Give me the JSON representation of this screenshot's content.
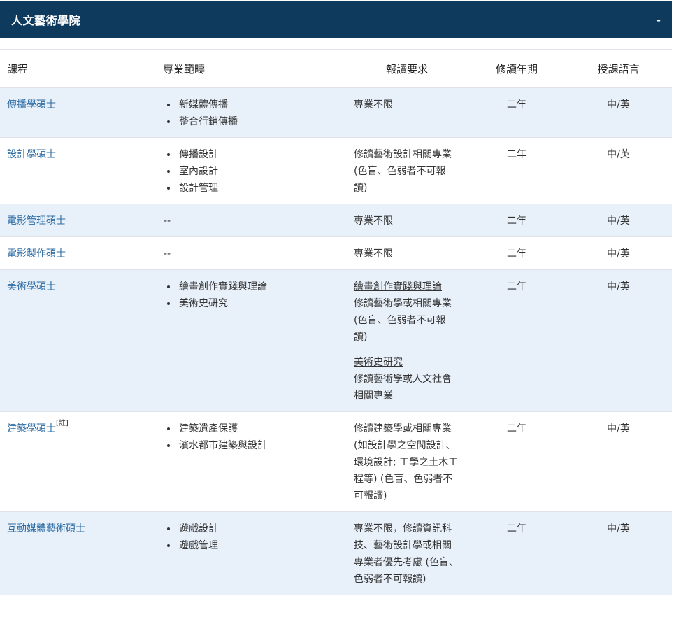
{
  "panel": {
    "title": "人文藝術學院",
    "toggle": "-"
  },
  "headers": {
    "course": "課程",
    "range": "專業範疇",
    "req": "報讀要求",
    "years": "修讀年期",
    "lang": "授課語言"
  },
  "rows": [
    {
      "course": "傳播學碩士",
      "note": "",
      "range": [
        "新媒體傳播",
        "整合行銷傳播"
      ],
      "req": [
        {
          "sub": "",
          "text": "專業不限"
        }
      ],
      "years": "二年",
      "lang": "中/英"
    },
    {
      "course": "設計學碩士",
      "note": "",
      "range": [
        "傳播設計",
        "室內設計",
        "設計管理"
      ],
      "req": [
        {
          "sub": "",
          "text": "修讀藝術設計相關專業(色盲、色弱者不可報讀)"
        }
      ],
      "years": "二年",
      "lang": "中/英"
    },
    {
      "course": "電影管理碩士",
      "note": "",
      "range_text": "--",
      "req": [
        {
          "sub": "",
          "text": "專業不限"
        }
      ],
      "years": "二年",
      "lang": "中/英"
    },
    {
      "course": "電影製作碩士",
      "note": "",
      "range_text": "--",
      "req": [
        {
          "sub": "",
          "text": "專業不限"
        }
      ],
      "years": "二年",
      "lang": "中/英"
    },
    {
      "course": "美術學碩士",
      "note": "",
      "range": [
        "繪畫創作實踐與理論",
        "美術史研究"
      ],
      "req": [
        {
          "sub": "繪畫創作實踐與理論",
          "text": "修讀藝術學或相關專業 (色盲、色弱者不可報讀)"
        },
        {
          "sub": "美術史研究",
          "text": "修讀藝術學或人文社會相關專業"
        }
      ],
      "years": "二年",
      "lang": "中/英"
    },
    {
      "course": "建築學碩士",
      "note": "[註]",
      "range": [
        "建築遺產保護",
        "濱水都市建築與設計"
      ],
      "req": [
        {
          "sub": "",
          "text": "修讀建築學或相關專業(如設計學之空間設計、環境設計; 工學之土木工程等) (色盲、色弱者不可報讀)"
        }
      ],
      "years": "二年",
      "lang": "中/英"
    },
    {
      "course": "互動媒體藝術碩士",
      "note": "",
      "range": [
        "遊戲設計",
        "遊戲管理"
      ],
      "req": [
        {
          "sub": "",
          "text": "專業不限，修讀資訊科技、藝術設計學或相關專業者優先考慮 (色盲、色弱者不可報讀)"
        }
      ],
      "years": "二年",
      "lang": "中/英"
    }
  ]
}
